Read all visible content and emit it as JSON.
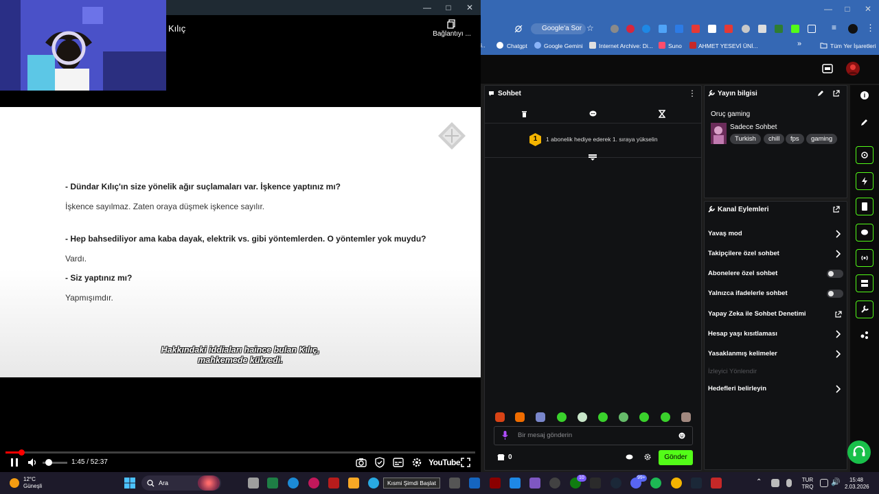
{
  "player": {
    "title": "Kılıç",
    "connect_label": "Bağlantıyı ...",
    "article": {
      "q1": "- Dündar Kılıç'ın size yönelik ağır suçlamaları var. İşkence yaptınız mı?",
      "a1": "İşkence sayılmaz. Zaten oraya düşmek işkence sayılır.",
      "q2": "- Hep bahsediliyor ama kaba dayak, elektrik vs. gibi yöntemlerden. O yöntemler yok muydu?",
      "a2": "Vardı.",
      "q3": "- Siz yaptınız mı?",
      "a3": "Yapmışımdır."
    },
    "caption_line1": "Hakkındaki iddiaları haince bulan Kılıç,",
    "caption_line2": "mahkemede kükredi.",
    "time": "1:45 / 52:37",
    "progress_fraction": 0.033,
    "volume_fraction": 0.15,
    "brand": "YouTube"
  },
  "browser": {
    "address_chip": "Google'a Sor",
    "bookmarks": [
      "Chatgpt",
      "Google Gemini",
      "Internet Archive: Di...",
      "Suno",
      "AHMET YESEVİ ÜNİ...",
      "Tüm Yer İşaretleri"
    ],
    "bookmark_overflow": "»"
  },
  "chat": {
    "title": "Sohbet",
    "rank_badge": "1",
    "gift_prompt": "1 abonelik hediye ederek 1. sıraya yükselin",
    "input_placeholder": "Bir mesaj gönderin",
    "count": "0",
    "send_label": "Gönder"
  },
  "stream_info": {
    "title": "Yayın bilgisi",
    "channel": "Oruç gaming",
    "category": "Sadece Sohbet",
    "tags": [
      "Turkish",
      "chill",
      "fps",
      "gaming"
    ]
  },
  "channel_actions": {
    "title": "Kanal Eylemleri",
    "items": [
      {
        "label": "Yavaş mod",
        "control": "chevron"
      },
      {
        "label": "Takipçilere özel sohbet",
        "control": "chevron"
      },
      {
        "label": "Abonelere özel sohbet",
        "control": "toggle"
      },
      {
        "label": "Yalnızca ifadelerle sohbet",
        "control": "toggle"
      },
      {
        "label": "Yapay Zeka ile Sohbet Denetimi",
        "control": "external"
      },
      {
        "label": "Hesap yaşı kısıtlaması",
        "control": "chevron"
      },
      {
        "label": "Yasaklanmış kelimeler",
        "control": "chevron"
      },
      {
        "label": "İzleyici Yönlendir",
        "control": "disabled"
      },
      {
        "label": "Hedefleri belirleyin",
        "control": "chevron"
      }
    ]
  },
  "taskbar": {
    "weather_temp": "12°C",
    "weather_desc": "Güneşli",
    "search_label": "Ara",
    "tooltip": "Kısmi Şimdi Başlat",
    "badge_a": "10",
    "badge_b": "99+",
    "lang_line1": "TUR",
    "lang_line2": "TRQ",
    "clock_time": "15:48",
    "clock_date": "2.03.2026"
  },
  "colors": {
    "accent_green": "#53fc18",
    "progress_red": "#ff0000",
    "chrome_blue": "#3568b4",
    "panel_bg": "#111214"
  }
}
